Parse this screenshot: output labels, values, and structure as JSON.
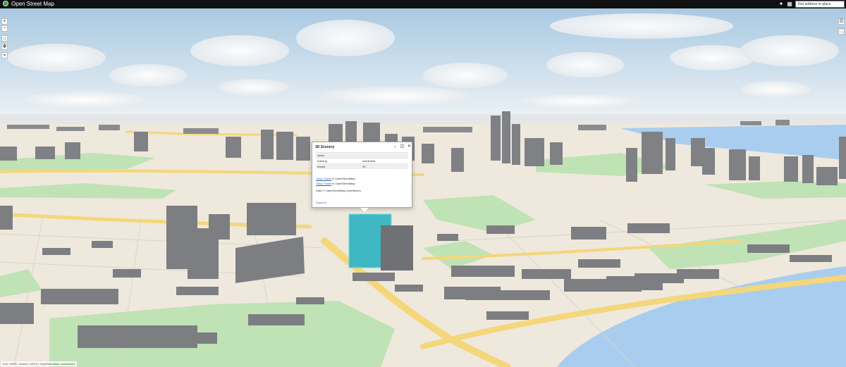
{
  "app": {
    "title": "Open Street Map",
    "search_value": "find address or place",
    "top_icons": [
      "settings-icon",
      "grid-icon"
    ]
  },
  "nav": {
    "zoom_in": "+",
    "zoom_out": "−",
    "home": "⌂",
    "compass": "✥",
    "locate": "⌖"
  },
  "right_tools": {
    "layers": "☰",
    "fullscreen": "⛶"
  },
  "attribution": {
    "text": "Esri, HERE, Garmin, USGS | OpenStreetMap contributors"
  },
  "popup": {
    "title": "3D Scenery",
    "fields": [
      {
        "key": "name",
        "value": ""
      },
      {
        "key": "building",
        "value": "residential"
      },
      {
        "key": "height",
        "value": "90"
      }
    ],
    "line1_link": "Tokyo Tower",
    "line1_rest": " in OpenStreetMap",
    "line2_link": "Tokyo Tower",
    "line2_rest": " in OpenStreetMap",
    "note": "Data © OpenStreetMap contributors",
    "zoom": "Zoom to"
  },
  "colors": {
    "sky_top": "#aecde6",
    "sky_bottom": "#e8f0f5",
    "land": "#efe8dc",
    "park": "#bfe3b4",
    "water": "#a9cdee",
    "building": "#7a7c80",
    "highlight": "#3fb8c4"
  }
}
